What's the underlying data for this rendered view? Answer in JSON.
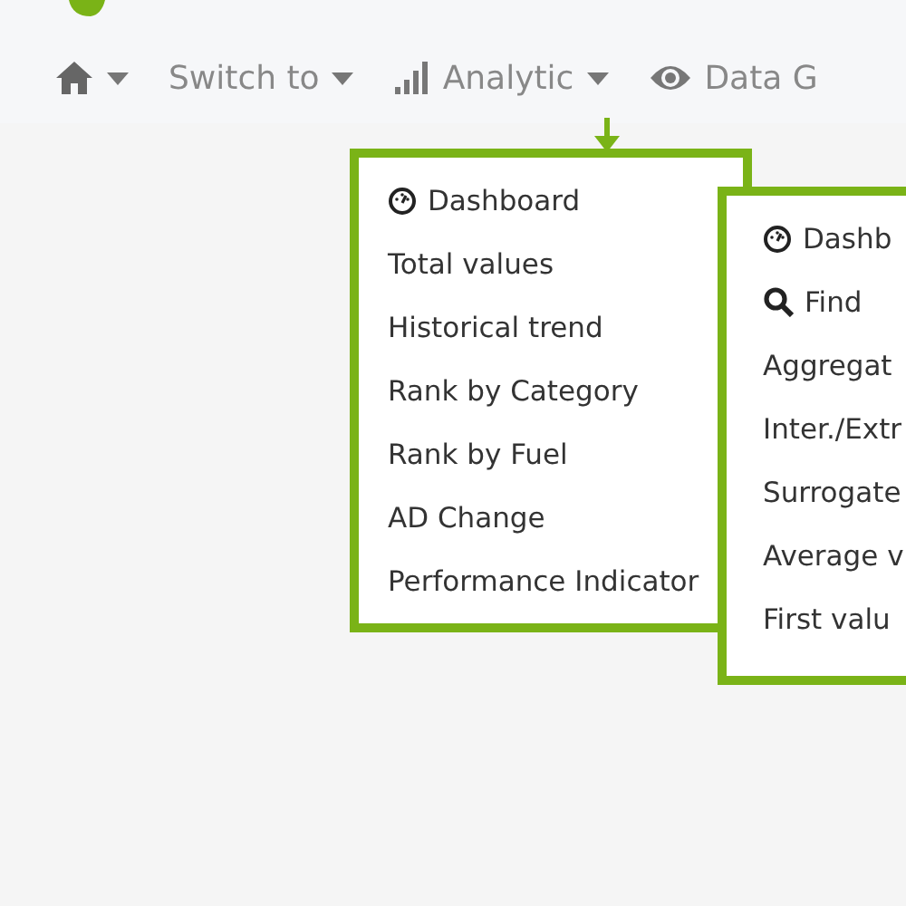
{
  "navbar": {
    "items": [
      {
        "kind": "home",
        "dropdown": true,
        "selected": false
      },
      {
        "kind": "text",
        "label": "Switch to",
        "dropdown": true,
        "selected": false
      },
      {
        "kind": "chart",
        "label": "Analytic",
        "dropdown": true,
        "selected": true
      },
      {
        "kind": "eye",
        "label": "Data G",
        "dropdown": false,
        "selected": false
      }
    ]
  },
  "menus": [
    {
      "items": [
        {
          "kind": "gauge",
          "label": "Dashboard"
        },
        {
          "label": "Total values"
        },
        {
          "label": "Historical trend"
        },
        {
          "label": "Rank by Category"
        },
        {
          "label": "Rank by Fuel"
        },
        {
          "label": "AD Change"
        },
        {
          "label": "Performance Indicator"
        }
      ]
    },
    {
      "items": [
        {
          "kind": "gauge",
          "label": "Dashb"
        },
        {
          "kind": "search",
          "label": "Find"
        },
        {
          "label": "Aggregat"
        },
        {
          "label": "Inter./Extr"
        },
        {
          "label": "Surrogate"
        },
        {
          "label": "Average v"
        },
        {
          "label": "First valu"
        }
      ]
    }
  ]
}
